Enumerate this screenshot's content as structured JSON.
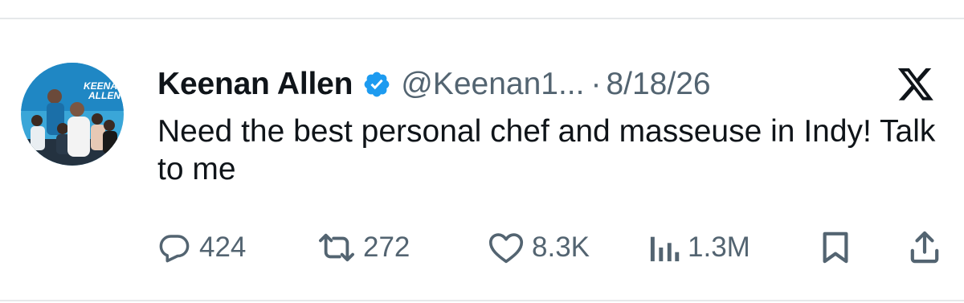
{
  "tweet": {
    "author_name": "Keenan Allen",
    "handle": "@Keenan1...",
    "separator": "·",
    "date": "8/18/26",
    "text": "Need the best personal chef and masseuse in Indy! Talk to me",
    "avatar_text": "KEENAN\nALLEN"
  },
  "actions": {
    "replies": "424",
    "reposts": "272",
    "likes": "8.3K",
    "views": "1.3M"
  },
  "icons": {
    "verified": "verified-badge-icon",
    "platform": "x-logo-icon",
    "reply": "reply-icon",
    "repost": "repost-icon",
    "like": "heart-icon",
    "views": "views-icon",
    "bookmark": "bookmark-icon",
    "share": "share-icon"
  },
  "colors": {
    "verified_blue": "#1d9bf0",
    "muted_text": "#536471",
    "text": "#0f1419"
  }
}
